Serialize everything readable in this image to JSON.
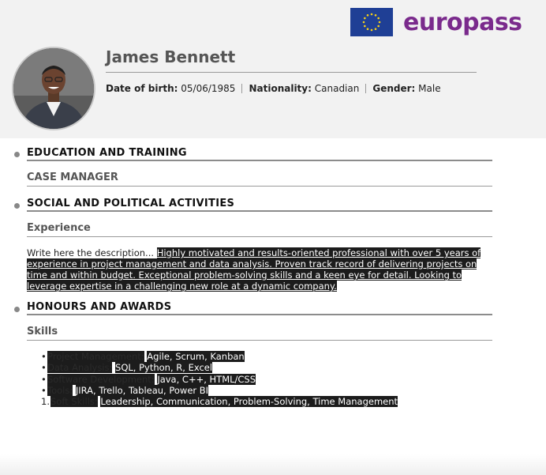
{
  "logo": {
    "text": "europass",
    "flag_color": "#1f3f95",
    "brand_color": "#7a2a8c"
  },
  "profile": {
    "name": "James Bennett",
    "dob_label": "Date of birth:",
    "dob_value": "05/06/1985",
    "nationality_label": "Nationality:",
    "nationality_value": "Canadian",
    "gender_label": "Gender:",
    "gender_value": "Male"
  },
  "sections": [
    {
      "title": "EDUCATION AND TRAINING",
      "subtitle": "CASE MANAGER"
    },
    {
      "title": "SOCIAL AND POLITICAL ACTIVITIES",
      "subtitle": "Experience"
    },
    {
      "title": "HONOURS AND AWARDS",
      "subtitle": "Skills"
    }
  ],
  "experience": {
    "prefix": "Write here the description...",
    "highlighted": "Highly motivated and results-oriented professional with over 5 years of experience in project management and data analysis. Proven track record of delivering projects on time and within budget. Exceptional problem-solving skills and a keen eye for detail. Looking to leverage expertise in a challenging new role at a dynamic company."
  },
  "skills": [
    {
      "marker": "•",
      "label": "Project Management:",
      "value": "Agile, Scrum, Kanban"
    },
    {
      "marker": "•",
      "label": "Data Analysis:",
      "value": "SQL, Python, R, Excel"
    },
    {
      "marker": "•",
      "label": "Software Development:",
      "value": "Java, C++, HTML/CSS"
    },
    {
      "marker": "•",
      "label": "Tools:",
      "value": "JIRA, Trello, Tableau, Power BI"
    },
    {
      "marker": "1.",
      "label": "Soft Skills:",
      "value": "Leadership, Communication, Problem-Solving, Time Management"
    }
  ]
}
